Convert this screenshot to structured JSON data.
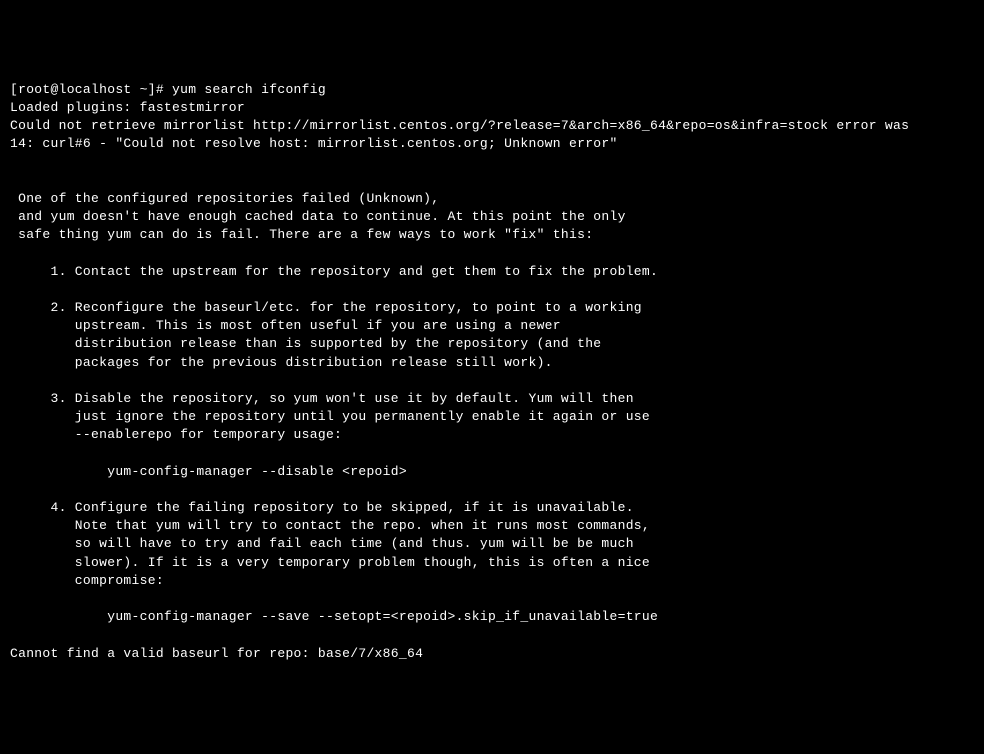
{
  "terminal": {
    "lines": [
      "[root@localhost ~]# yum search ifconfig",
      "Loaded plugins: fastestmirror",
      "Could not retrieve mirrorlist http://mirrorlist.centos.org/?release=7&arch=x86_64&repo=os&infra=stock error was",
      "14: curl#6 - \"Could not resolve host: mirrorlist.centos.org; Unknown error\"",
      "",
      "",
      " One of the configured repositories failed (Unknown),",
      " and yum doesn't have enough cached data to continue. At this point the only",
      " safe thing yum can do is fail. There are a few ways to work \"fix\" this:",
      "",
      "     1. Contact the upstream for the repository and get them to fix the problem.",
      "",
      "     2. Reconfigure the baseurl/etc. for the repository, to point to a working",
      "        upstream. This is most often useful if you are using a newer",
      "        distribution release than is supported by the repository (and the",
      "        packages for the previous distribution release still work).",
      "",
      "     3. Disable the repository, so yum won't use it by default. Yum will then",
      "        just ignore the repository until you permanently enable it again or use",
      "        --enablerepo for temporary usage:",
      "",
      "            yum-config-manager --disable <repoid>",
      "",
      "     4. Configure the failing repository to be skipped, if it is unavailable.",
      "        Note that yum will try to contact the repo. when it runs most commands,",
      "        so will have to try and fail each time (and thus. yum will be be much",
      "        slower). If it is a very temporary problem though, this is often a nice",
      "        compromise:",
      "",
      "            yum-config-manager --save --setopt=<repoid>.skip_if_unavailable=true",
      "",
      "Cannot find a valid baseurl for repo: base/7/x86_64"
    ]
  }
}
